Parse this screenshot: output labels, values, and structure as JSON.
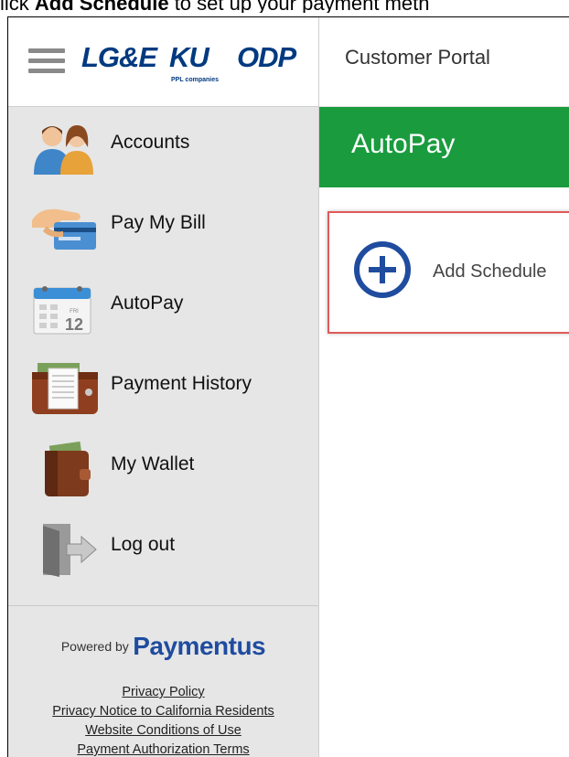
{
  "caption": {
    "prefix": "lick ",
    "bold": "Add Schedule",
    "suffix": " to set up your payment meth"
  },
  "header": {
    "logo": {
      "brand_1": "LG&E",
      "brand_2": "KU",
      "brand_3": "ODP",
      "tagline": "PPL companies"
    },
    "portal_title": "Customer Portal"
  },
  "sidebar": {
    "items": [
      {
        "label": "Accounts",
        "icon": "people-icon"
      },
      {
        "label": "Pay My Bill",
        "icon": "card-hand-icon"
      },
      {
        "label": "AutoPay",
        "icon": "calendar-icon",
        "calendar_day": "12",
        "calendar_tag": "FRI"
      },
      {
        "label": "Payment History",
        "icon": "wallet-receipts-icon"
      },
      {
        "label": "My Wallet",
        "icon": "wallet-icon"
      },
      {
        "label": "Log out",
        "icon": "logout-door-icon"
      }
    ],
    "footer": {
      "powered_by": "Powered by",
      "brand": "Paymentus",
      "links": [
        "Privacy Policy",
        "Privacy Notice to California Residents",
        "Website Conditions of Use",
        "Payment Authorization Terms"
      ]
    }
  },
  "main": {
    "banner_title": "AutoPay",
    "add_schedule_label": "Add Schedule"
  },
  "colors": {
    "banner_green": "#1a9c3e",
    "brand_blue": "#1f4c9f",
    "highlight_red": "#e05a5a",
    "sidebar_bg": "#e6e6e6"
  }
}
